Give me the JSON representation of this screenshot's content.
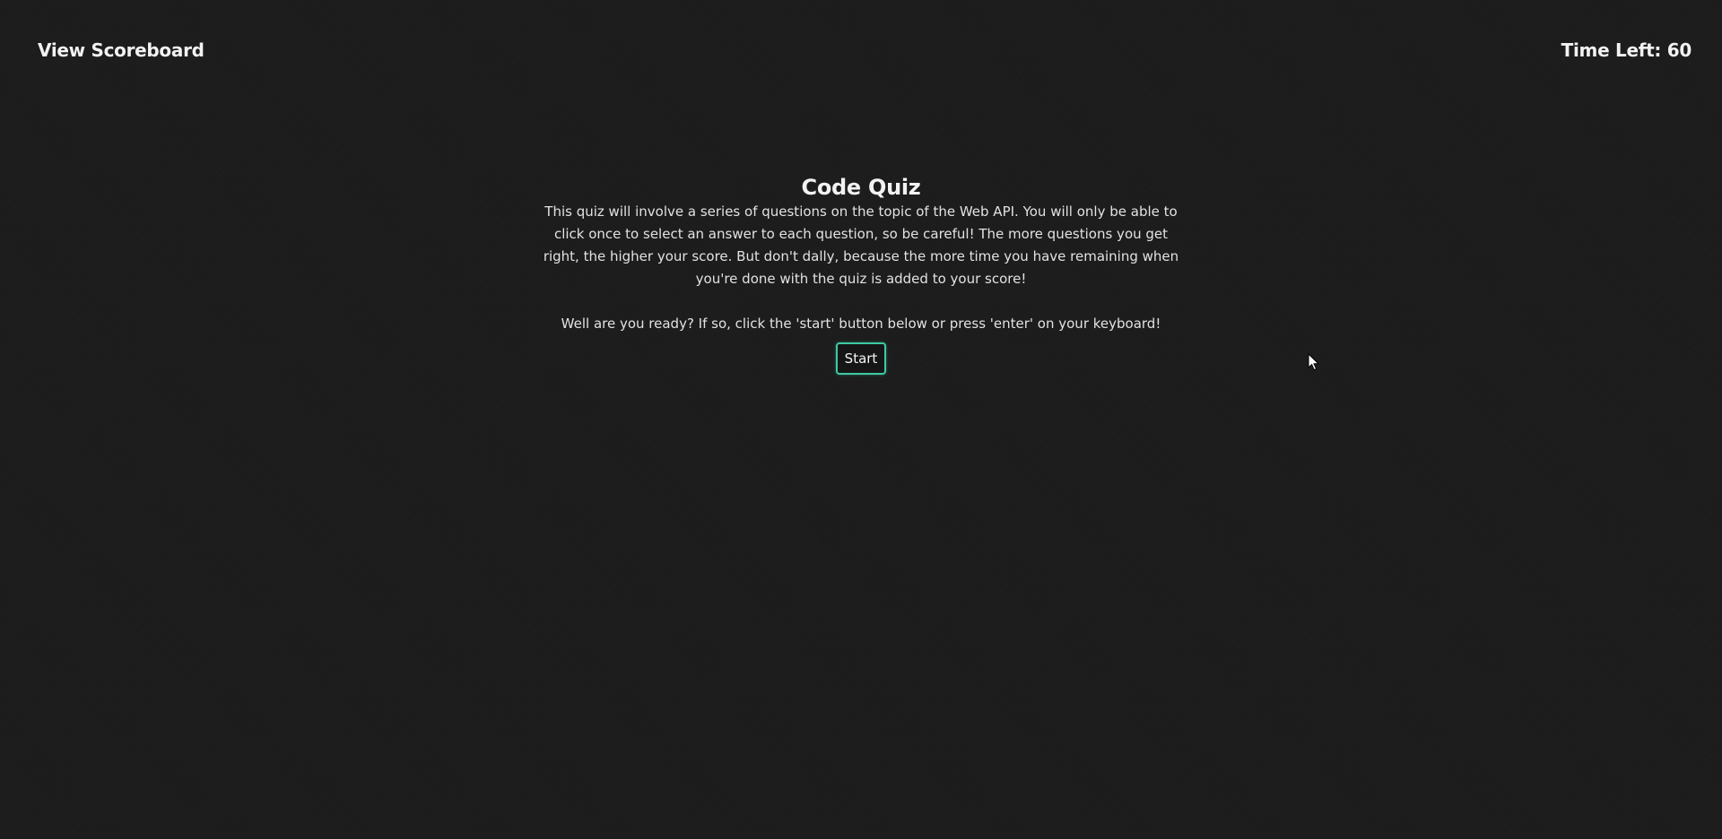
{
  "header": {
    "scoreboard_link": "View Scoreboard",
    "timer_label": "Time Left: 60"
  },
  "quiz": {
    "title": "Code Quiz",
    "intro": "This quiz will involve a series of questions on the topic of the Web API. You will only be able to click once to select an answer to each question, so be careful! The more questions you get right, the higher your score. But don't dally, because the more time you have remaining when you're done with the quiz is added to your score!",
    "prompt": "Well are you ready? If so, click the 'start' button below or press 'enter' on your keyboard!",
    "start_label": "Start"
  },
  "colors": {
    "background": "#1c1c1c",
    "text": "#f2f2f2",
    "accent": "#3ec9a4"
  },
  "icons": {
    "cursor": "mouse-pointer-icon"
  }
}
